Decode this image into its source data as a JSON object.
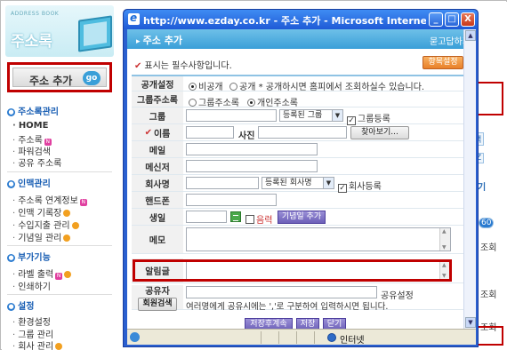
{
  "sidebar": {
    "brand_sub": "ADDRESS BOOK",
    "brand_title": "주소록",
    "add_button_label": "주소 추가",
    "go_label": "go",
    "sections": [
      {
        "title": "주소록관리",
        "items": [
          "HOME",
          "주소록",
          "파워검색",
          "공유 주소록"
        ]
      },
      {
        "title": "인맥관리",
        "items": [
          "주소록 연계정보",
          "인맥 기록장",
          "수입지출 관리",
          "기념일 관리"
        ]
      },
      {
        "title": "부가기능",
        "items": [
          "라벨 출력",
          "인쇄하기"
        ]
      },
      {
        "title": "설정",
        "items": [
          "환경설정",
          "그룹 관리",
          "회사 관리"
        ]
      }
    ],
    "new_badge": "N"
  },
  "background": {
    "right_labels": [
      "색",
      "Z",
      "기",
      "60",
      "조회",
      "조회",
      "조회"
    ]
  },
  "popup": {
    "window_title": "http://www.ezday.co.kr - 주소 추가 - Microsoft Internet ...",
    "min_label": "_",
    "max_label": "□",
    "close_label": "X",
    "header_title": "주소 추가",
    "header_link": "묻고답하기",
    "required_note": "표시는 필수사항입니다.",
    "help_button": "항목설정",
    "form": {
      "public_label": "공개설정",
      "public_opt1": "비공개",
      "public_opt2": "공개 * 공개하시면 홈피에서 조회하실수 있습니다.",
      "group_addr_label": "그룹주소록",
      "group_addr_opt1": "그룹주소록",
      "group_addr_opt2": "개인주소록",
      "group_label": "그룹",
      "group_select": "등록된 그룹",
      "group_register": "그룹등록",
      "name_label": "이름",
      "photo_label": "사진",
      "browse_button": "찾아보기...",
      "email_label": "메일",
      "messenger_label": "메신저",
      "company_label": "회사명",
      "company_select": "등록된 회사명",
      "company_register": "회사등록",
      "phone_label": "핸드폰",
      "birthday_label": "생일",
      "lunar_label": "음력",
      "anniversary_button": "기념일 추가",
      "memo_label": "메모",
      "alert_label": "알림글",
      "sharer_label": "공유자",
      "member_search_button": "회원검색",
      "share_setting": "공유설정",
      "share_hint": "여러명에게 공유시에는 ','로 구분하여 입력하시면 됩니다."
    },
    "buttons": {
      "save_continue": "저장후계속",
      "save": "저장",
      "close": "닫기"
    },
    "status": {
      "zone": "인터넷"
    }
  }
}
